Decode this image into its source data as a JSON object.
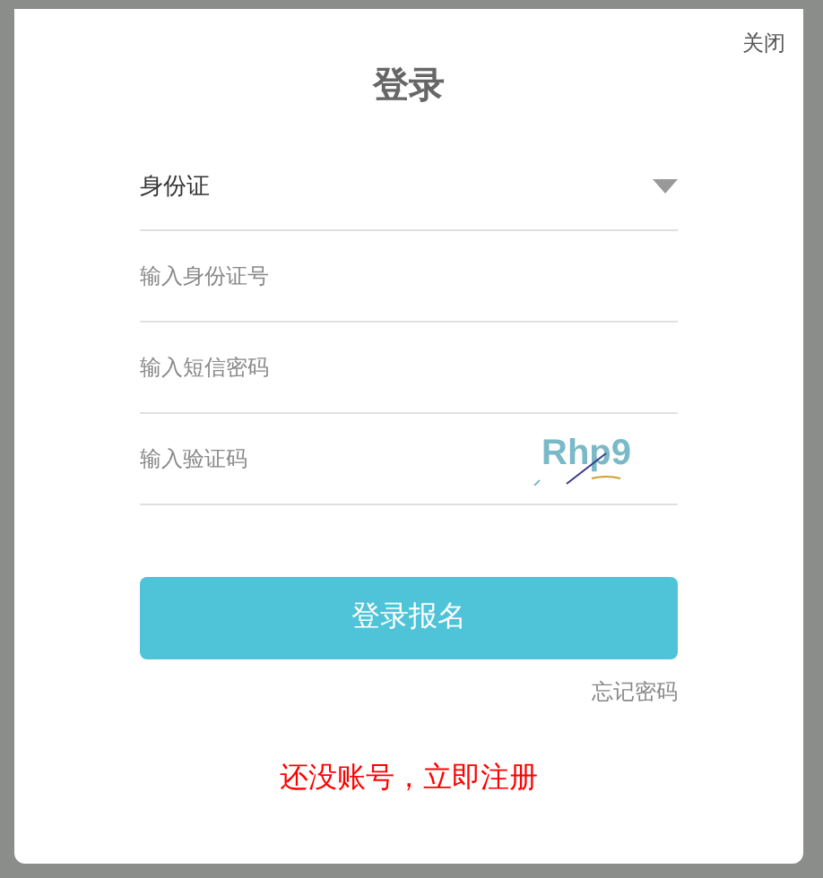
{
  "dialog": {
    "close": "关闭",
    "title": "登录"
  },
  "id_type": {
    "value": "身份证"
  },
  "fields": [
    {
      "kind": "text",
      "placeholder": "输入身份证号"
    },
    {
      "kind": "text",
      "placeholder": "输入短信密码"
    },
    {
      "kind": "captcha",
      "placeholder": "输入验证码",
      "captcha": "Rhp9"
    }
  ],
  "submit": "登录报名",
  "forgot": "忘记密码",
  "register": "还没账号，立即注册"
}
